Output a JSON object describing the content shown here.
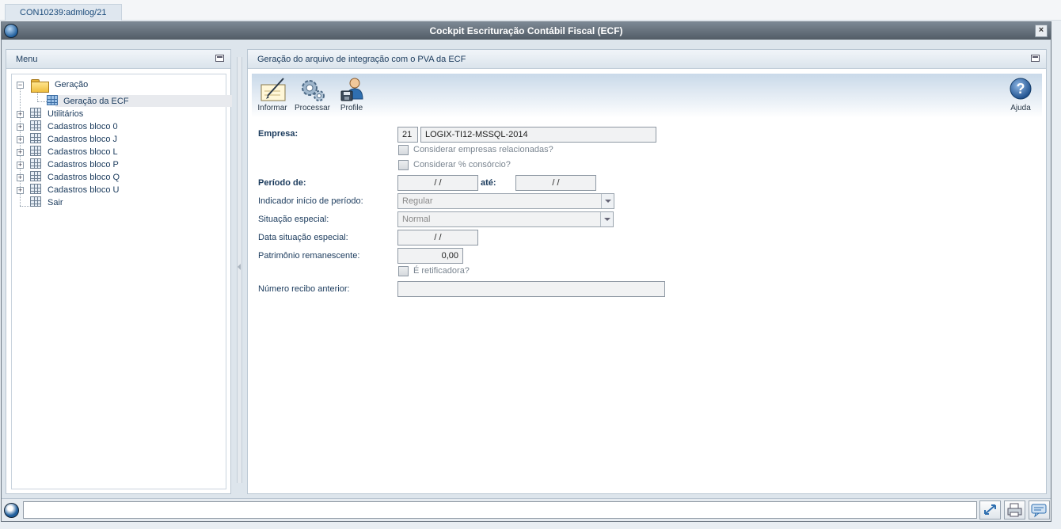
{
  "tab": {
    "label": "CON10239:admlog/21"
  },
  "window": {
    "title": "Cockpit Escrituração Contábil Fiscal (ECF)",
    "close_label": "×"
  },
  "menu": {
    "title": "Menu",
    "items": [
      {
        "label": "Geração"
      },
      {
        "label": "Geração da ECF"
      },
      {
        "label": "Utilitários"
      },
      {
        "label": "Cadastros bloco 0"
      },
      {
        "label": "Cadastros bloco J"
      },
      {
        "label": "Cadastros bloco L"
      },
      {
        "label": "Cadastros bloco P"
      },
      {
        "label": "Cadastros bloco Q"
      },
      {
        "label": "Cadastros bloco U"
      },
      {
        "label": "Sair"
      }
    ],
    "expander_glyph": "+",
    "collapse_glyph": "−"
  },
  "main": {
    "title": "Geração do arquivo de integração com o PVA da ECF",
    "toolbar": {
      "informar": "Informar",
      "processar": "Processar",
      "profile": "Profile",
      "ajuda": "Ajuda",
      "ajuda_glyph": "?"
    },
    "form": {
      "empresa_label": "Empresa:",
      "empresa_code": "21",
      "empresa_name": "LOGIX-TI12-MSSQL-2014",
      "relacionadas_label": "Considerar empresas relacionadas?",
      "consorcio_label": "Considerar % consórcio?",
      "periodo_de_label": "Período de:",
      "periodo_de_value": " /  /",
      "ate_label": "até:",
      "ate_value": " /  /",
      "indicador_label": "Indicador início de período:",
      "indicador_value": "Regular",
      "situacao_label": "Situação especial:",
      "situacao_value": "Normal",
      "data_situacao_label": "Data situação especial:",
      "data_situacao_value": " /  /",
      "patrimonio_label": "Patrimônio remanescente:",
      "patrimonio_value": "0,00",
      "retificadora_label": "É retificadora?",
      "recibo_label": "Número recibo anterior:",
      "recibo_value": ""
    }
  },
  "colors": {
    "accent": "#1f5e9c",
    "titlebar": "#5d6873",
    "toolbar": "#c9d9e9"
  }
}
